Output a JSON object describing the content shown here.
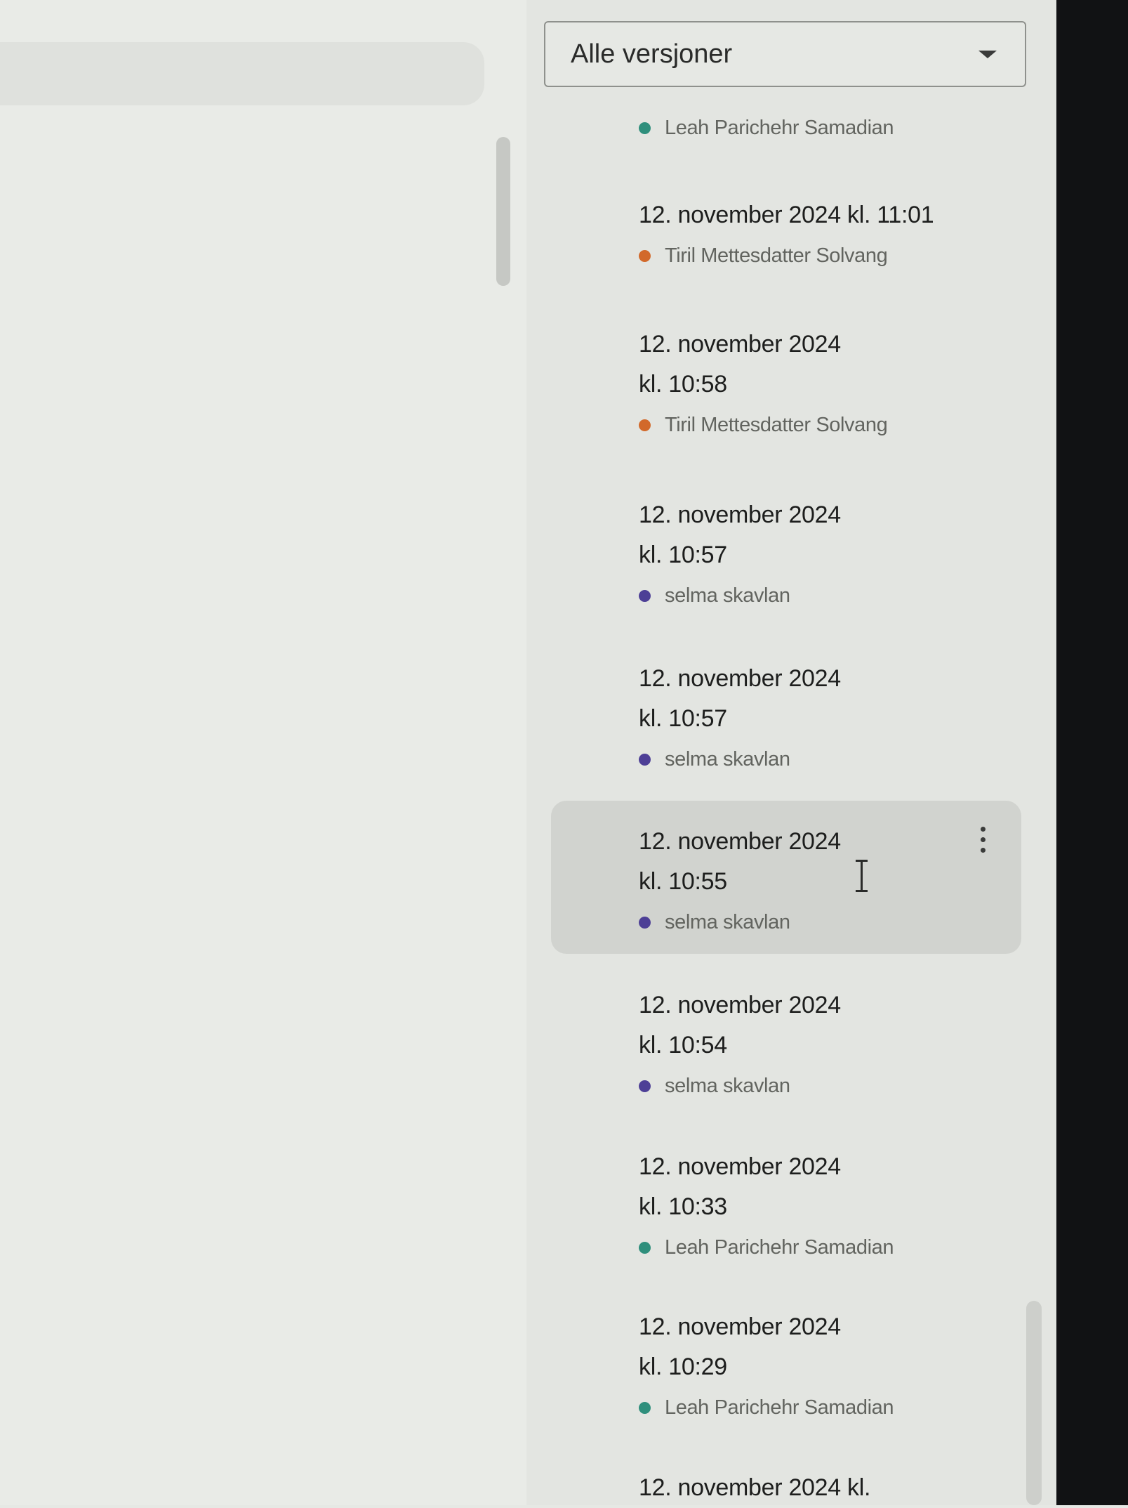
{
  "filter": {
    "label": "Alle versjoner"
  },
  "colors": {
    "teal": "#2f8f7c",
    "orange": "#d2692a",
    "purple": "#4d3f96"
  },
  "versions": [
    {
      "time": "",
      "author": "Leah Parichehr Samadian",
      "color": "#2f8f7c"
    },
    {
      "time": "12. november 2024 kl. 11:01",
      "author": "Tiril Mettesdatter Solvang",
      "color": "#d2692a"
    },
    {
      "time": "12. november 2024 kl. 10:58",
      "author": "Tiril Mettesdatter Solvang",
      "color": "#d2692a"
    },
    {
      "time": "12. november 2024 kl. 10:57",
      "author": "selma skavlan",
      "color": "#4d3f96"
    },
    {
      "time": "12. november 2024 kl. 10:57",
      "author": "selma skavlan",
      "color": "#4d3f96"
    },
    {
      "time": "12. november 2024 kl. 10:55",
      "author": "selma skavlan",
      "color": "#4d3f96",
      "selected": true
    },
    {
      "time": "12. november 2024 kl. 10:54",
      "author": "selma skavlan",
      "color": "#4d3f96"
    },
    {
      "time": "12. november 2024 kl. 10:33",
      "author": "Leah Parichehr Samadian",
      "color": "#2f8f7c"
    },
    {
      "time": "12. november 2024 kl. 10:29",
      "author": "Leah Parichehr Samadian",
      "color": "#2f8f7c"
    },
    {
      "time": "12. november 2024 kl.",
      "author": "",
      "color": ""
    }
  ],
  "icons": {
    "dropdown": "chevron-down-icon",
    "more": "more-vert-icon",
    "cursor": "text-cursor-icon"
  }
}
